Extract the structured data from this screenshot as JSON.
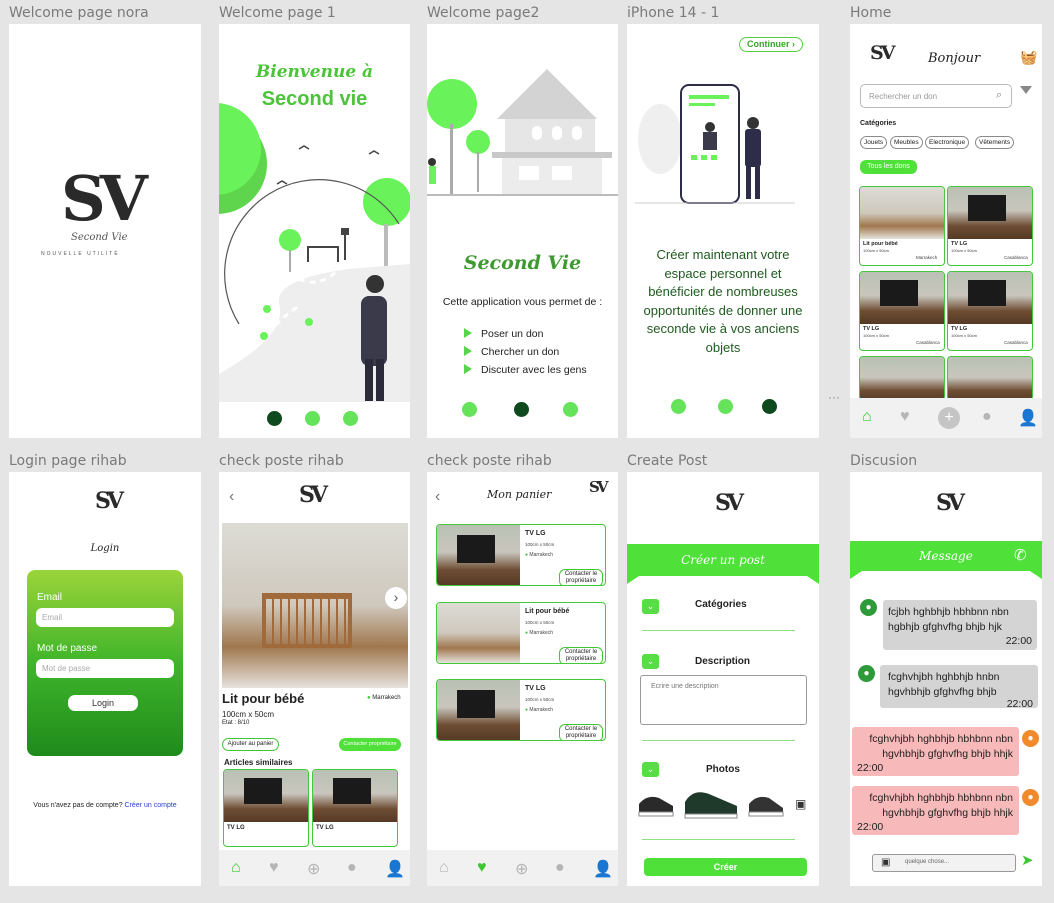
{
  "frames": {
    "welcome_nora": {
      "label": "Welcome page nora",
      "logo_text": "Second Vie",
      "logo_tagline": "NOUVELLE UTILITÉ"
    },
    "welcome1": {
      "label": "Welcome page 1",
      "title_line1": "Bienvenue à",
      "title_line2": "Second vie"
    },
    "welcome2": {
      "label": "Welcome page2",
      "title": "Second Vie",
      "intro": "Cette application vous permet de :",
      "items": [
        "Poser un don",
        "Chercher  un don",
        "Discuter avec les gens"
      ]
    },
    "iphone14": {
      "label": "iPhone 14 - 1",
      "continue_btn": "Continuer",
      "message": "Créer maintenant votre espace personnel et bénéficier de nombreuses opportunités de donner une seconde vie à vos anciens objets"
    },
    "home": {
      "label": "Home",
      "greeting": "Bonjour",
      "search_placeholder": "Rechercher un don",
      "categories_title": "Catégories",
      "categories": [
        "Jouets",
        "Meubles",
        "Electronique",
        "Vêtements"
      ],
      "all_button": "Tous les dons",
      "cards": [
        {
          "title": "Lit pour bébé",
          "sub": "100cm x 50cm",
          "city": "Marrakech"
        },
        {
          "title": "TV LG",
          "sub": "100cm x 50cm",
          "city": "Casablanca"
        },
        {
          "title": "TV LG",
          "sub": "100cm x 50cm",
          "city": "Casablanca"
        },
        {
          "title": "TV LG",
          "sub": "100cm x 50cm",
          "city": "Casablanca"
        }
      ]
    },
    "login": {
      "label": "Login page rihab",
      "title": "Login",
      "email_label": "Email",
      "email_placeholder": "Email",
      "password_label": "Mot de passe",
      "password_placeholder": "Mot de passe",
      "button": "Login",
      "no_account": "Vous n'avez pas de compte?",
      "create_link": "Créer un compte"
    },
    "check1": {
      "label": "check poste rihab",
      "product": "Lit pour bébé",
      "size": "100cm x 50cm",
      "state": "Etat : 8/10",
      "city": "Marrakech",
      "add_cart": "Ajouter au panier",
      "contact": "Contacter propriétaire",
      "similar_title": "Articles similaires",
      "similar": [
        "TV LG",
        "TV LG"
      ]
    },
    "check2": {
      "label": "check poste rihab",
      "title": "Mon panier",
      "items": [
        {
          "title": "TV LG",
          "size": "100cm x 50cm",
          "city": "Marrakech",
          "action": "Contacter le propriétaire"
        },
        {
          "title": "Lit pour bébé",
          "size": "100cm x 50cm",
          "city": "Marrakech",
          "action": "Contacter le propriétaire"
        },
        {
          "title": "TV LG",
          "size": "100cm x 50cm",
          "city": "Marrakech",
          "action": "Contacter le propriétaire"
        }
      ]
    },
    "create": {
      "label": "Create Post",
      "header": "Créer un post",
      "categories": "Catégories",
      "description": "Description",
      "desc_placeholder": "Ecrire une description",
      "photos": "Photos",
      "button": "Créer"
    },
    "discussion": {
      "label": "Discusion",
      "header": "Message",
      "messages": [
        {
          "text": "fcjbh hghbhjb hbhbnn nbn hgbhjb gfghvfhg bhjb hjk",
          "time": "22:00"
        },
        {
          "text": "fcghvhjbh hghbhjb hnbn hgvhbhjb gfghvfhg bhjb",
          "time": "22:00"
        },
        {
          "text": "fcghvhjbh hghbhjb hbhbnn nbn hgvhbhjb gfghvfhg bhjb hhjk",
          "time": "22:00"
        },
        {
          "text": "fcghvhjbh hghbhjb hbhbnn nbn hgvhbhjb gfghvfhg bhjb hhjk",
          "time": "22:00"
        }
      ],
      "input_placeholder": "quelque chose..."
    }
  },
  "logo_letters": "SV",
  "colors": {
    "accent": "#4fe03a",
    "dark_green": "#0f4a1e",
    "received_bubble": "#d4d4d4",
    "sent_bubble": "#f7b9b9"
  }
}
